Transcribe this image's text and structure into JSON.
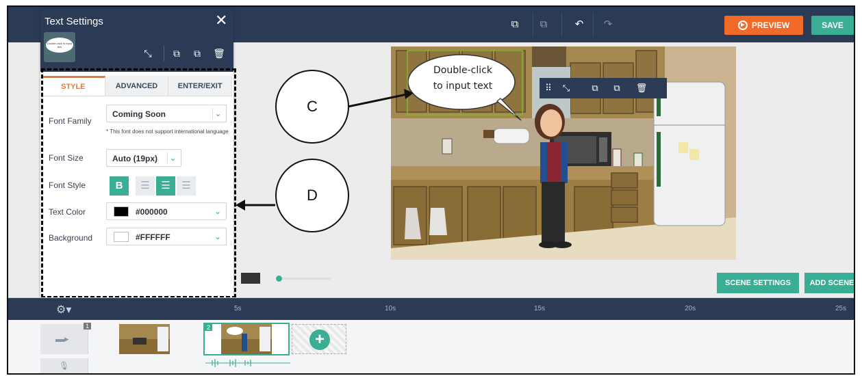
{
  "panel": {
    "title": "Text Settings",
    "close_icon": "close-icon",
    "thumb_text": "Double-click to input text",
    "tabs": [
      "STYLE",
      "ADVANCED",
      "ENTER/EXIT"
    ],
    "font_family": {
      "label": "Font Family",
      "value": "Coming Soon",
      "note": "* This font does not support international language"
    },
    "font_size": {
      "label": "Font Size",
      "value": "Auto (19px)"
    },
    "font_style": {
      "label": "Font Style",
      "bold": "B"
    },
    "text_color": {
      "label": "Text Color",
      "value": "#000000",
      "swatch": "#000000"
    },
    "background": {
      "label": "Background",
      "value": "#FFFFFF",
      "swatch": "#FFFFFF"
    }
  },
  "toolbar": {
    "preview_label": "PREVIEW",
    "save_label": "SAVE"
  },
  "scene": {
    "bubble_text_1": "Double-click",
    "bubble_text_2": "to input text"
  },
  "callouts": {
    "c": "C",
    "d": "D"
  },
  "buttons": {
    "scene_settings": "SCENE SETTINGS",
    "add_scene": "ADD SCENE"
  },
  "timeline": {
    "ticks": [
      "5s",
      "10s",
      "15s",
      "20s",
      "25s"
    ],
    "clips": [
      {
        "number": "1"
      },
      {
        "number": "2"
      }
    ]
  },
  "colors": {
    "nav": "#2b3a55",
    "accent": "#3aae94",
    "preview": "#f16a2a"
  }
}
